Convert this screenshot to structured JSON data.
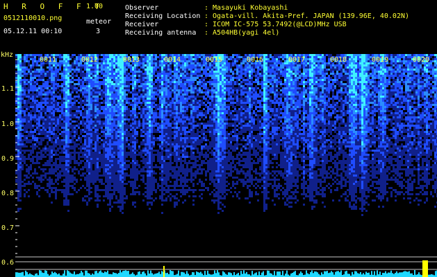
{
  "app": {
    "title": "H R O F F T",
    "version": "1.00",
    "filename": "0512110010.png",
    "datetime": "05.12.11 00:10",
    "meteor_label": "meteor",
    "meteor_count": "3"
  },
  "info": {
    "observer_label": "Observer",
    "observer_value": ": Masayuki Kobayashi",
    "location_label": "Receiving Location",
    "location_value": ": Ogata-vill. Akita-Pref. JAPAN (139.96E, 40.02N)",
    "receiver_label": "Receiver",
    "receiver_value": ": ICOM IC-575 53.7492(@LCD)MHz USB",
    "antenna_label": "Receiving antenna",
    "antenna_value": ": A504HB(yagi 4el)"
  },
  "axis": {
    "unit": "kHz",
    "ticks": [
      "1.1",
      "1.0",
      "0.9",
      "0.8",
      "0.7",
      "0.6"
    ]
  },
  "time_labels": [
    "0011",
    "0012",
    "0013",
    "0014",
    "0015",
    "0016",
    "0017",
    "0018",
    "0019",
    "0020"
  ],
  "colors": {
    "background": "#000000",
    "label_yellow": "#ffff33",
    "signal_cyan": "#00ffff",
    "noise_blue": "#1e3cff"
  }
}
